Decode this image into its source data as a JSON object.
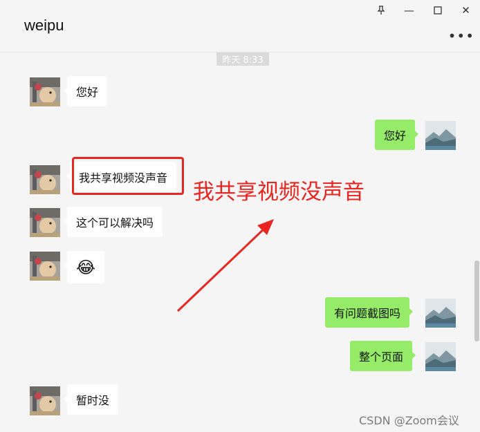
{
  "window": {
    "title": "weipu",
    "controls": {
      "pin": "⚲",
      "minimize": "—",
      "maximize": "☐",
      "close": "✕"
    },
    "more": "•••"
  },
  "timestamp": "昨天 8:33",
  "messages": [
    {
      "side": "left",
      "text": "您好"
    },
    {
      "side": "right",
      "text": "您好"
    },
    {
      "side": "left",
      "text": "我共享视频没声音"
    },
    {
      "side": "left",
      "text": "这个可以解决吗"
    },
    {
      "side": "left",
      "text": "😂"
    },
    {
      "side": "right",
      "text": "有问题截图吗"
    },
    {
      "side": "right",
      "text": "整个页面"
    },
    {
      "side": "left",
      "text": "暂时没"
    }
  ],
  "annotation": {
    "text": "我共享视频没声音",
    "color": "#e8251e"
  },
  "watermark": "CSDN @Zoom会议",
  "colors": {
    "accent_bubble": "#95ec69",
    "annotation_red": "#e8251e"
  }
}
